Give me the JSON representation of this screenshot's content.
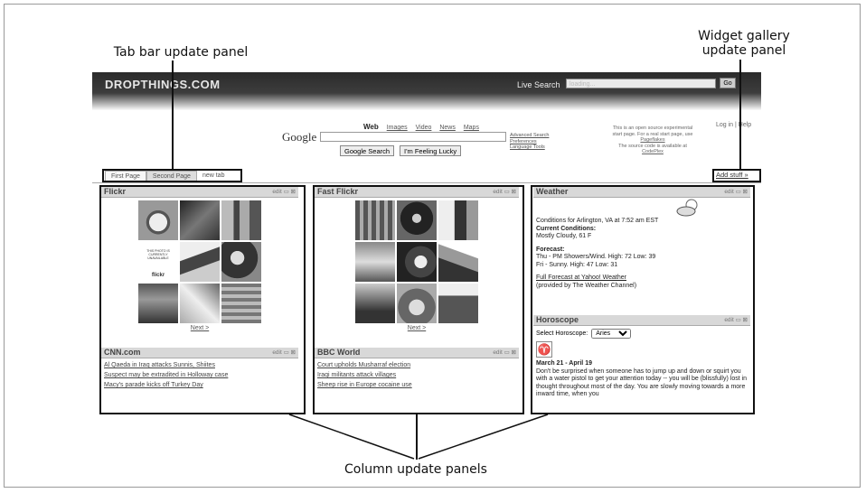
{
  "callouts": {
    "tab_bar": "Tab bar update panel",
    "widget_gallery_line1": "Widget gallery",
    "widget_gallery_line2": "update panel",
    "column": "Column update panels"
  },
  "app": {
    "logo": "DROPTHINGS.COM",
    "live_search_label": "Live Search",
    "live_search_value": "loading...",
    "live_search_button": "Go",
    "login_help": "Log in | Help"
  },
  "google": {
    "brand": "Google",
    "tabs": [
      "Web",
      "Images",
      "Video",
      "News",
      "Maps"
    ],
    "search_button": "Google Search",
    "lucky_button": "I'm Feeling Lucky",
    "advanced": "Advanced Search",
    "preferences": "Preferences",
    "language": "Language Tools"
  },
  "description": {
    "line1": "This is an open source experimental",
    "line2": "start page. For a real start page, use",
    "line3": "Pageflakes",
    "line4": "The source code is available at",
    "line5": "CodePlex"
  },
  "tabs": [
    "First Page",
    "Second Page",
    "new tab"
  ],
  "add_stuff": "Add stuff »",
  "widget_tools": "edit ▭ ⊠",
  "widgets": {
    "flickr": {
      "title": "Flickr",
      "next": "Next >",
      "logo_text": "flickr",
      "placeholder": "THIS PHOTO IS CURRENTLY UNAVAILABLE"
    },
    "fast_flickr": {
      "title": "Fast Flickr",
      "next": "Next >"
    },
    "cnn": {
      "title": "CNN.com",
      "links": [
        "Al Qaeda in Iraq attacks Sunnis, Shiites",
        "Suspect may be extradited in Holloway case",
        "Macy's parade kicks off Turkey Day"
      ]
    },
    "bbc": {
      "title": "BBC World",
      "links": [
        "Court upholds Musharraf election",
        "Iraqi militants attack villages",
        "Sheep rise in Europe cocaine use"
      ]
    },
    "weather": {
      "title": "Weather",
      "conditions_for": "Conditions for Arlington, VA at 7:52 am EST",
      "current_label": "Current Conditions:",
      "current_value": "Mostly Cloudy, 61 F",
      "forecast_label": "Forecast:",
      "forecast_1": "Thu - PM Showers/Wind. High: 72 Low: 39",
      "forecast_2": "Fri - Sunny. High: 47 Low: 31",
      "full_forecast": "Full Forecast at Yahoo! Weather",
      "provided_by": "(provided by The Weather Channel)"
    },
    "horoscope": {
      "title": "Horoscope",
      "select_label": "Select Horoscope:",
      "selected": "Aries",
      "dates": "March 21 - April 19",
      "text": "Don't be surprised when someone has to jump up and down or squirt you with a water pistol to get your attention today -- you will be (blissfully) lost in thought throughout most of the day. You are slowly moving towards a more inward time, when you"
    }
  }
}
